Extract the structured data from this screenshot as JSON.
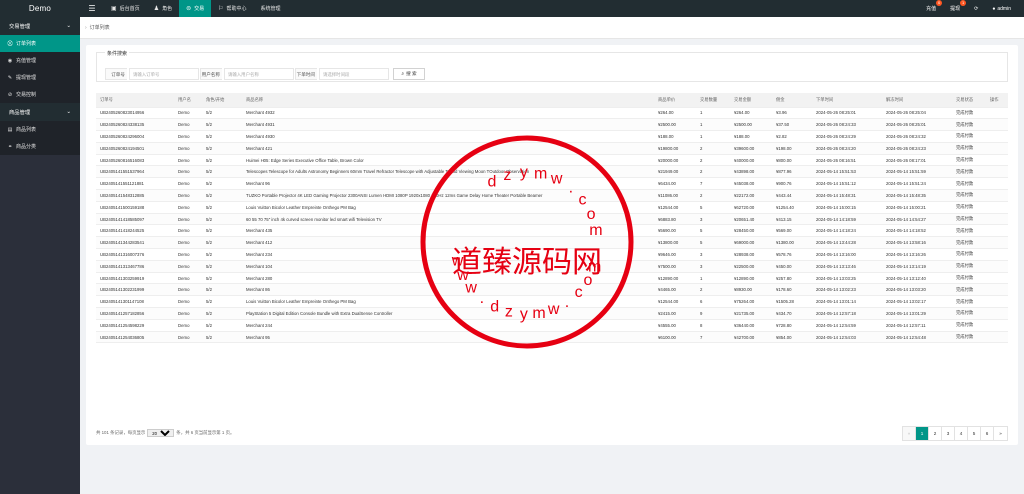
{
  "brand": "Demo",
  "topnav": [
    {
      "icon": "home-icon",
      "glyph": "▣",
      "label": "后台首页",
      "active": false
    },
    {
      "icon": "user-icon",
      "glyph": "♟",
      "label": "角色",
      "active": false
    },
    {
      "icon": "exchange-icon",
      "glyph": "⊜",
      "label": "交易",
      "active": true
    },
    {
      "icon": "flag-icon",
      "glyph": "⚐",
      "label": "帮助中心",
      "active": false
    },
    {
      "icon": "settings-icon",
      "glyph": "",
      "label": "系统管理",
      "active": false
    }
  ],
  "topright": {
    "recharge": "充值",
    "recharge_badge": "0",
    "withdraw": "提现",
    "withdraw_badge": "1",
    "user": "admin"
  },
  "sidebar": [
    {
      "type": "group",
      "label": "交易管理",
      "name": "sidebar-group-trade"
    },
    {
      "type": "item",
      "label": "订单列表",
      "glyph": "⛒",
      "icon": "cart-icon",
      "active": true,
      "name": "sidebar-item-orders"
    },
    {
      "type": "item",
      "label": "充值管理",
      "glyph": "◉",
      "icon": "coin-icon",
      "active": false,
      "name": "sidebar-item-recharge"
    },
    {
      "type": "item",
      "label": "提现管理",
      "glyph": "✎",
      "icon": "withdraw-icon",
      "active": false,
      "name": "sidebar-item-withdraw"
    },
    {
      "type": "item",
      "label": "交易控制",
      "glyph": "⊘",
      "icon": "control-icon",
      "active": false,
      "name": "sidebar-item-control"
    },
    {
      "type": "group",
      "label": "商品管理",
      "name": "sidebar-group-goods"
    },
    {
      "type": "item",
      "label": "商品列表",
      "glyph": "▤",
      "icon": "list-icon",
      "active": false,
      "name": "sidebar-item-goods-list"
    },
    {
      "type": "item",
      "label": "商品分类",
      "glyph": "⚭",
      "icon": "link-icon",
      "active": false,
      "name": "sidebar-item-goods-category"
    }
  ],
  "breadcrumb": "订单列表",
  "search": {
    "legend": "条件搜索",
    "order_label": "订单号",
    "order_placeholder": "请输入订单号",
    "user_label": "用户名称",
    "user_placeholder": "请输入用户名称",
    "time_label": "下单时间",
    "time_placeholder": "请选择时间段",
    "button": "搜 索"
  },
  "table": {
    "headers": [
      "订单号",
      "用户名",
      "角色/开始",
      "商品名称",
      "商品单价",
      "交易数量",
      "交易金额",
      "佣金",
      "下单时间",
      "解冻时间",
      "交易状态",
      "操作"
    ],
    "rows": [
      [
        "UB2405260823014956",
        "Demo",
        "5/2",
        "Merchant 4932",
        "¥264.00",
        "1",
        "¥264.00",
        "¥3.96",
        "2024-05-26 08:25:01",
        "2024-05-26 08:25:04",
        "完成付款",
        ""
      ],
      [
        "UB2405260824338135",
        "Demo",
        "5/2",
        "Merchant 4931",
        "¥2500.00",
        "1",
        "¥2500.00",
        "¥37.50",
        "2024-05-26 08:24:33",
        "2024-05-26 08:25:01",
        "完成付款",
        ""
      ],
      [
        "UB2405260824296004",
        "Demo",
        "5/2",
        "Merchant 4930",
        "¥188.00",
        "1",
        "¥188.00",
        "¥2.82",
        "2024-05-26 08:24:29",
        "2024-05-26 08:24:32",
        "完成付款",
        ""
      ],
      [
        "UB2405260824194501",
        "Demo",
        "5/2",
        "Merchant 421",
        "¥19800.00",
        "2",
        "¥39600.00",
        "¥198.00",
        "2024-05-26 08:24:20",
        "2024-05-26 08:24:23",
        "完成付款",
        ""
      ],
      [
        "UB2405260816516083",
        "Demo",
        "5/2",
        "Huimei H05: Edge Series Executive Office Table, Brown Color",
        "¥20000.00",
        "2",
        "¥40000.00",
        "¥800.00",
        "2024-05-26 08:16:51",
        "2024-05-26 08:17:01",
        "完成付款",
        ""
      ],
      [
        "UB2405141551537964",
        "Demo",
        "5/2",
        "Telescopes Telescope for Adults Astronomy Beginners 60mm Travel Refractor Telescope with Adjustable Tripod Viewing Moon TOutdoor Observation",
        "¥21949.00",
        "2",
        "¥43898.00",
        "¥877.96",
        "2024-05-14 15:51:53",
        "2024-05-14 15:51:59",
        "完成付款",
        ""
      ],
      [
        "UB2405141551121881",
        "Demo",
        "5/2",
        "Merchant 96",
        "¥6434.00",
        "7",
        "¥45038.00",
        "¥900.76",
        "2024-05-14 15:51:12",
        "2024-05-14 15:51:24",
        "完成付款",
        ""
      ],
      [
        "UB2405141548312885",
        "Demo",
        "5/2",
        "TUZKO Portable Projector 4K LED Gaming Projector 2300ANSI Lumen HDMI 1080P 1920x1080 120Hz 12ms Game Delay Home Theater Portable Beamer",
        "¥11086.00",
        "2",
        "¥22172.00",
        "¥443.44",
        "2024-05-14 15:48:31",
        "2024-05-14 15:48:35",
        "完成付款",
        ""
      ],
      [
        "UB2405141500159188",
        "Demo",
        "5/2",
        "Louis Vuitton Bicolor Leather Empreinte Onthego PM Bag",
        "¥12544.00",
        "5",
        "¥62720.00",
        "¥1254.40",
        "2024-05-14 15:00:15",
        "2024-05-14 15:00:21",
        "完成付款",
        ""
      ],
      [
        "UB2405141418585097",
        "Demo",
        "5/2",
        "60 55 70 75\" inch 4k curved screen monitor led smart wifi Television TV",
        "¥6883.80",
        "3",
        "¥20651.40",
        "¥413.15",
        "2024-05-14 14:18:59",
        "2024-05-14 14:54:27",
        "完成付款",
        ""
      ],
      [
        "UB2405141418244525",
        "Demo",
        "5/2",
        "Merchant 435",
        "¥5690.00",
        "5",
        "¥28450.00",
        "¥569.00",
        "2024-05-14 14:18:24",
        "2024-05-14 14:18:52",
        "完成付款",
        ""
      ],
      [
        "UB2405141344283541",
        "Demo",
        "5/2",
        "Merchant 412",
        "¥13800.00",
        "5",
        "¥69000.00",
        "¥1380.00",
        "2024-05-14 13:44:28",
        "2024-05-14 13:58:16",
        "完成付款",
        ""
      ],
      [
        "UB2405141316007376",
        "Demo",
        "5/2",
        "Merchant 234",
        "¥9646.00",
        "3",
        "¥28938.00",
        "¥578.76",
        "2024-05-14 13:16:00",
        "2024-05-14 13:16:26",
        "完成付款",
        ""
      ],
      [
        "UB2405141313467786",
        "Demo",
        "5/2",
        "Merchant 104",
        "¥7500.00",
        "3",
        "¥22500.00",
        "¥450.00",
        "2024-05-14 13:13:46",
        "2024-05-14 13:14:19",
        "完成付款",
        ""
      ],
      [
        "UB2405141303259919",
        "Demo",
        "5/2",
        "Merchant 280",
        "¥12890.00",
        "1",
        "¥12890.00",
        "¥257.80",
        "2024-05-14 13:03:25",
        "2024-05-14 13:12:40",
        "完成付款",
        ""
      ],
      [
        "UB2405141302231999",
        "Demo",
        "5/2",
        "Merchant 86",
        "¥4465.00",
        "2",
        "¥8930.00",
        "¥178.60",
        "2024-05-14 13:02:23",
        "2024-05-14 13:03:20",
        "完成付款",
        ""
      ],
      [
        "UB2405141301147108",
        "Demo",
        "5/2",
        "Louis Vuitton Bicolor Leather Empreinte Onthego PM Bag",
        "¥12544.00",
        "6",
        "¥75264.00",
        "¥1505.28",
        "2024-05-14 13:01:14",
        "2024-05-14 13:02:17",
        "完成付款",
        ""
      ],
      [
        "UB2405141257182856",
        "Demo",
        "5/2",
        "PlayStation 5 Digital Edition Console Bundle with Extra DualSense Controller",
        "¥2415.00",
        "9",
        "¥21735.00",
        "¥434.70",
        "2024-05-14 12:57:18",
        "2024-05-14 13:01:29",
        "完成付款",
        ""
      ],
      [
        "UB2405141254598229",
        "Demo",
        "5/2",
        "Merchant 244",
        "¥4555.00",
        "8",
        "¥36440.00",
        "¥728.80",
        "2024-05-14 12:54:59",
        "2024-05-14 12:57:11",
        "完成付款",
        ""
      ],
      [
        "UB2405141254036805",
        "Demo",
        "5/2",
        "Merchant 95",
        "¥6100.00",
        "7",
        "¥42700.00",
        "¥854.00",
        "2024-05-14 12:54:03",
        "2024-05-14 12:54:48",
        "完成付款",
        ""
      ]
    ]
  },
  "footer": {
    "prefix": "共 101 条记录，每页显示",
    "per_page": "20",
    "suffix": "条，共 6 页当前显示第 1 页。",
    "pages": [
      "«",
      "1",
      "2",
      "3",
      "4",
      "5",
      "6",
      "»"
    ],
    "current_page": "1"
  },
  "watermark": {
    "main": "道臻源码网",
    "top_letters": "dzymw.com",
    "bottom_letters": "www.dzymw.com"
  },
  "colors": {
    "accent": "#009688",
    "topbar": "#222d32",
    "sidebar": "#2b2f3a",
    "seal": "#e60012"
  }
}
